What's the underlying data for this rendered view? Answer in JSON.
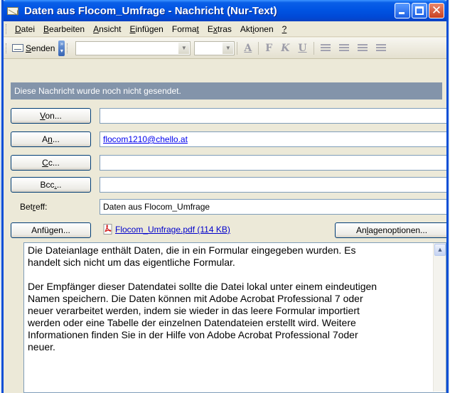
{
  "window": {
    "title": "Daten aus Flocom_Umfrage - Nachricht (Nur-Text)"
  },
  "menu": {
    "items": [
      {
        "pre": "",
        "u": "D",
        "post": "atei"
      },
      {
        "pre": "",
        "u": "B",
        "post": "earbeiten"
      },
      {
        "pre": "",
        "u": "A",
        "post": "nsicht"
      },
      {
        "pre": "",
        "u": "E",
        "post": "infügen"
      },
      {
        "pre": "Forma",
        "u": "t",
        "post": ""
      },
      {
        "pre": "E",
        "u": "x",
        "post": "tras"
      },
      {
        "pre": "Akt",
        "u": "i",
        "post": "onen"
      },
      {
        "pre": "",
        "u": "?",
        "post": ""
      }
    ]
  },
  "toolbar": {
    "send_pre": "",
    "send_u": "S",
    "send_post": "enden",
    "bold": "F",
    "italic": "K",
    "underline": "U",
    "font_color": "A"
  },
  "compose": {
    "status": "Diese Nachricht wurde noch nicht gesendet.",
    "from_label": {
      "pre": "",
      "u": "V",
      "post": "on..."
    },
    "to_label": {
      "pre": "A",
      "u": "n",
      "post": "..."
    },
    "cc_label": {
      "pre": "",
      "u": "C",
      "post": "c..."
    },
    "bcc_label": {
      "pre": "Bcc",
      "u": ".",
      "post": ".."
    },
    "from_value": "",
    "to_value": "flocom1210@chello.at",
    "cc_value": "",
    "bcc_value": "",
    "subject_label": {
      "pre": "Bet",
      "u": "r",
      "post": "eff:"
    },
    "subject_value": "Daten aus Flocom_Umfrage",
    "attach_button": "Anfügen...",
    "attachment": "Flocom_Umfrage.pdf (114 KB)",
    "attach_options": {
      "pre": "An",
      "u": "l",
      "post": "agenoptionen..."
    }
  },
  "message": {
    "body": "Die Dateianlage enthält Daten, die in ein Formular eingegeben wurden. Es\nhandelt sich nicht um das eigentliche Formular.\n\nDer Empfänger dieser Datendatei sollte die Datei lokal unter einem eindeutigen\nNamen speichern. Die Daten können mit Adobe Acrobat Professional 7 oder\nneuer verarbeitet werden, indem sie wieder in das leere Formular importiert\nwerden oder eine Tabelle der einzelnen Datendateien erstellt wird. Weitere\nInformationen finden Sie in der Hilfe von Adobe Acrobat Professional 7oder\nneuer."
  }
}
